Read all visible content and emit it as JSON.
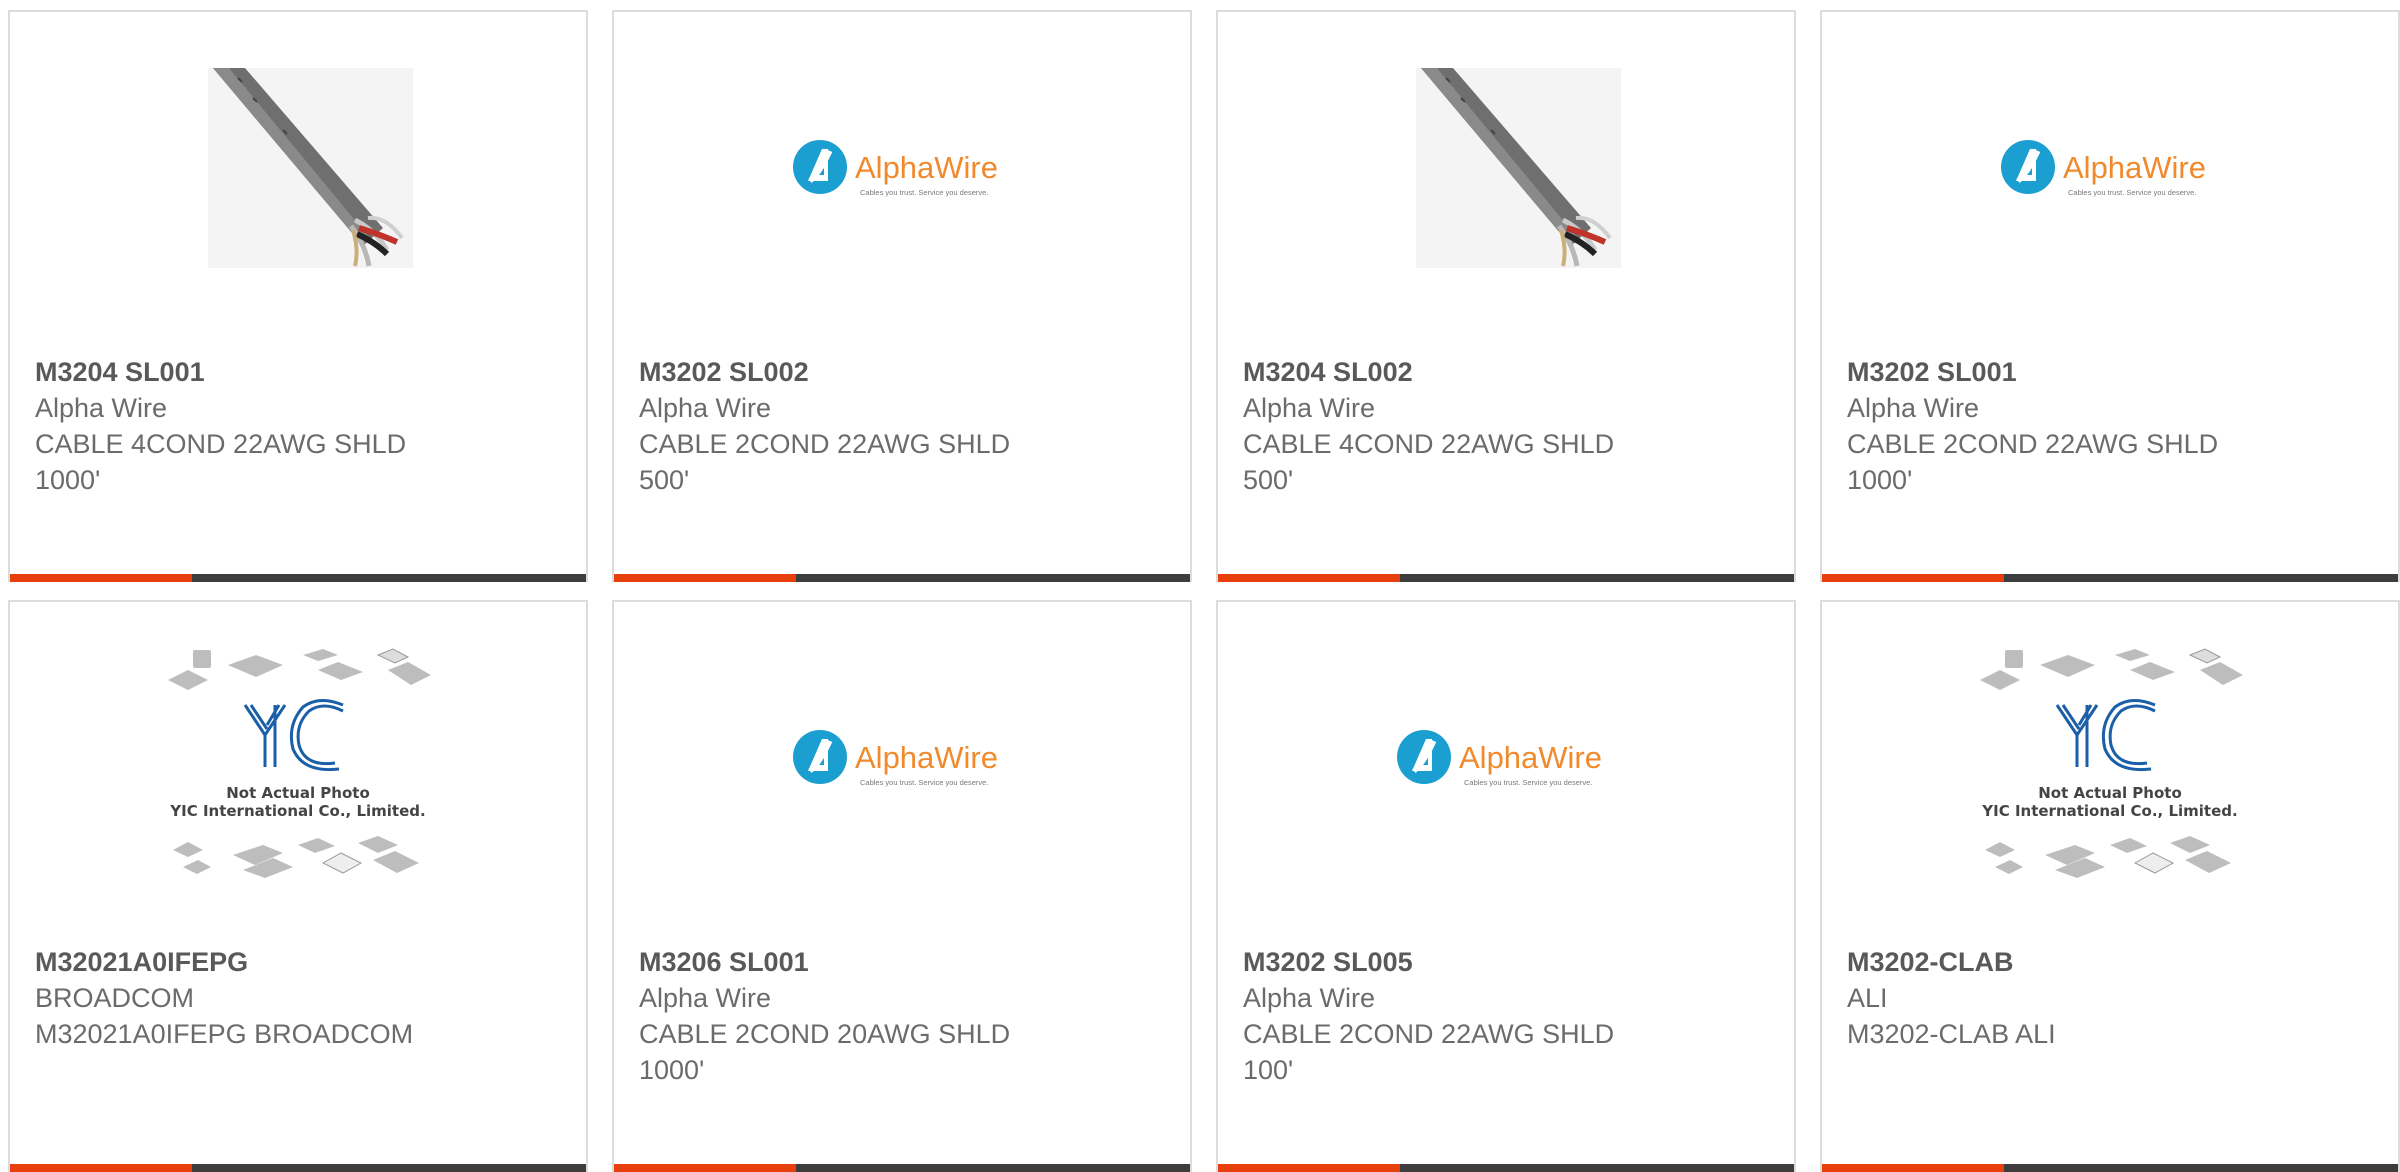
{
  "colors": {
    "accent": "#e8400c",
    "bar_dark": "#3d3d3d",
    "alpha_blue": "#1a9fd0",
    "alpha_orange": "#f08a2c",
    "yic_blue": "#1b5fa8"
  },
  "placeholder_text": {
    "yic_line1": "Not Actual Photo",
    "yic_line2": "YIC International Co., Limited.",
    "alpha_brand": "AlphaWire",
    "alpha_tagline": "Cables you trust. Service you deserve."
  },
  "products": [
    {
      "part_number": "M3204 SL001",
      "manufacturer": "Alpha Wire",
      "description": "CABLE 4COND 22AWG SHLD\n1000'",
      "image": "cable-photo"
    },
    {
      "part_number": "M3202 SL002",
      "manufacturer": "Alpha Wire",
      "description": "CABLE 2COND 22AWG SHLD\n500'",
      "image": "alphawire-logo"
    },
    {
      "part_number": "M3204 SL002",
      "manufacturer": "Alpha Wire",
      "description": "CABLE 4COND 22AWG SHLD\n500'",
      "image": "cable-photo"
    },
    {
      "part_number": "M3202 SL001",
      "manufacturer": "Alpha Wire",
      "description": "CABLE 2COND 22AWG SHLD\n1000'",
      "image": "alphawire-logo"
    },
    {
      "part_number": "M32021A0IFEPG",
      "manufacturer": "BROADCOM",
      "description": "M32021A0IFEPG BROADCOM",
      "image": "yic-placeholder"
    },
    {
      "part_number": "M3206 SL001",
      "manufacturer": "Alpha Wire",
      "description": "CABLE 2COND 20AWG SHLD\n1000'",
      "image": "alphawire-logo"
    },
    {
      "part_number": "M3202 SL005",
      "manufacturer": "Alpha Wire",
      "description": "CABLE 2COND 22AWG SHLD\n100'",
      "image": "alphawire-logo"
    },
    {
      "part_number": "M3202-CLAB",
      "manufacturer": "ALI",
      "description": "M3202-CLAB ALI",
      "image": "yic-placeholder"
    }
  ]
}
